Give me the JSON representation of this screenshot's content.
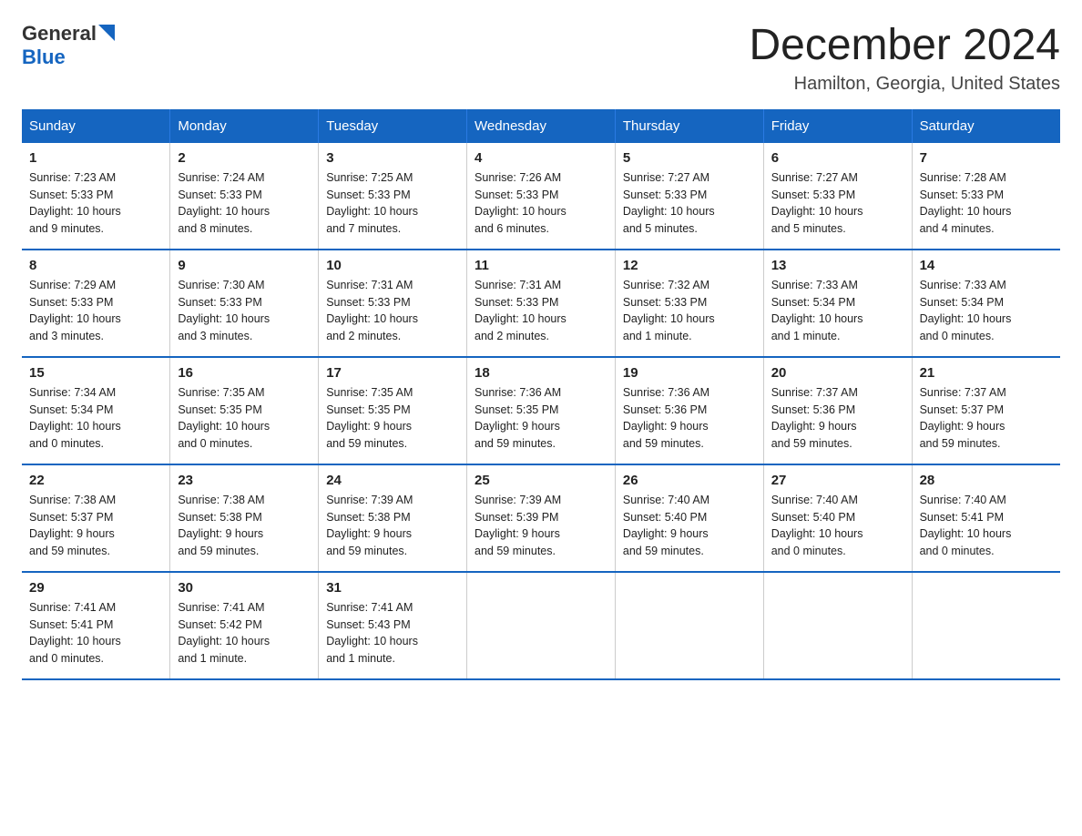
{
  "header": {
    "title": "December 2024",
    "location": "Hamilton, Georgia, United States",
    "logo_general": "General",
    "logo_blue": "Blue"
  },
  "weekdays": [
    "Sunday",
    "Monday",
    "Tuesday",
    "Wednesday",
    "Thursday",
    "Friday",
    "Saturday"
  ],
  "rows": [
    [
      {
        "day": "1",
        "info": "Sunrise: 7:23 AM\nSunset: 5:33 PM\nDaylight: 10 hours\nand 9 minutes."
      },
      {
        "day": "2",
        "info": "Sunrise: 7:24 AM\nSunset: 5:33 PM\nDaylight: 10 hours\nand 8 minutes."
      },
      {
        "day": "3",
        "info": "Sunrise: 7:25 AM\nSunset: 5:33 PM\nDaylight: 10 hours\nand 7 minutes."
      },
      {
        "day": "4",
        "info": "Sunrise: 7:26 AM\nSunset: 5:33 PM\nDaylight: 10 hours\nand 6 minutes."
      },
      {
        "day": "5",
        "info": "Sunrise: 7:27 AM\nSunset: 5:33 PM\nDaylight: 10 hours\nand 5 minutes."
      },
      {
        "day": "6",
        "info": "Sunrise: 7:27 AM\nSunset: 5:33 PM\nDaylight: 10 hours\nand 5 minutes."
      },
      {
        "day": "7",
        "info": "Sunrise: 7:28 AM\nSunset: 5:33 PM\nDaylight: 10 hours\nand 4 minutes."
      }
    ],
    [
      {
        "day": "8",
        "info": "Sunrise: 7:29 AM\nSunset: 5:33 PM\nDaylight: 10 hours\nand 3 minutes."
      },
      {
        "day": "9",
        "info": "Sunrise: 7:30 AM\nSunset: 5:33 PM\nDaylight: 10 hours\nand 3 minutes."
      },
      {
        "day": "10",
        "info": "Sunrise: 7:31 AM\nSunset: 5:33 PM\nDaylight: 10 hours\nand 2 minutes."
      },
      {
        "day": "11",
        "info": "Sunrise: 7:31 AM\nSunset: 5:33 PM\nDaylight: 10 hours\nand 2 minutes."
      },
      {
        "day": "12",
        "info": "Sunrise: 7:32 AM\nSunset: 5:33 PM\nDaylight: 10 hours\nand 1 minute."
      },
      {
        "day": "13",
        "info": "Sunrise: 7:33 AM\nSunset: 5:34 PM\nDaylight: 10 hours\nand 1 minute."
      },
      {
        "day": "14",
        "info": "Sunrise: 7:33 AM\nSunset: 5:34 PM\nDaylight: 10 hours\nand 0 minutes."
      }
    ],
    [
      {
        "day": "15",
        "info": "Sunrise: 7:34 AM\nSunset: 5:34 PM\nDaylight: 10 hours\nand 0 minutes."
      },
      {
        "day": "16",
        "info": "Sunrise: 7:35 AM\nSunset: 5:35 PM\nDaylight: 10 hours\nand 0 minutes."
      },
      {
        "day": "17",
        "info": "Sunrise: 7:35 AM\nSunset: 5:35 PM\nDaylight: 9 hours\nand 59 minutes."
      },
      {
        "day": "18",
        "info": "Sunrise: 7:36 AM\nSunset: 5:35 PM\nDaylight: 9 hours\nand 59 minutes."
      },
      {
        "day": "19",
        "info": "Sunrise: 7:36 AM\nSunset: 5:36 PM\nDaylight: 9 hours\nand 59 minutes."
      },
      {
        "day": "20",
        "info": "Sunrise: 7:37 AM\nSunset: 5:36 PM\nDaylight: 9 hours\nand 59 minutes."
      },
      {
        "day": "21",
        "info": "Sunrise: 7:37 AM\nSunset: 5:37 PM\nDaylight: 9 hours\nand 59 minutes."
      }
    ],
    [
      {
        "day": "22",
        "info": "Sunrise: 7:38 AM\nSunset: 5:37 PM\nDaylight: 9 hours\nand 59 minutes."
      },
      {
        "day": "23",
        "info": "Sunrise: 7:38 AM\nSunset: 5:38 PM\nDaylight: 9 hours\nand 59 minutes."
      },
      {
        "day": "24",
        "info": "Sunrise: 7:39 AM\nSunset: 5:38 PM\nDaylight: 9 hours\nand 59 minutes."
      },
      {
        "day": "25",
        "info": "Sunrise: 7:39 AM\nSunset: 5:39 PM\nDaylight: 9 hours\nand 59 minutes."
      },
      {
        "day": "26",
        "info": "Sunrise: 7:40 AM\nSunset: 5:40 PM\nDaylight: 9 hours\nand 59 minutes."
      },
      {
        "day": "27",
        "info": "Sunrise: 7:40 AM\nSunset: 5:40 PM\nDaylight: 10 hours\nand 0 minutes."
      },
      {
        "day": "28",
        "info": "Sunrise: 7:40 AM\nSunset: 5:41 PM\nDaylight: 10 hours\nand 0 minutes."
      }
    ],
    [
      {
        "day": "29",
        "info": "Sunrise: 7:41 AM\nSunset: 5:41 PM\nDaylight: 10 hours\nand 0 minutes."
      },
      {
        "day": "30",
        "info": "Sunrise: 7:41 AM\nSunset: 5:42 PM\nDaylight: 10 hours\nand 1 minute."
      },
      {
        "day": "31",
        "info": "Sunrise: 7:41 AM\nSunset: 5:43 PM\nDaylight: 10 hours\nand 1 minute."
      },
      {
        "day": "",
        "info": ""
      },
      {
        "day": "",
        "info": ""
      },
      {
        "day": "",
        "info": ""
      },
      {
        "day": "",
        "info": ""
      }
    ]
  ]
}
